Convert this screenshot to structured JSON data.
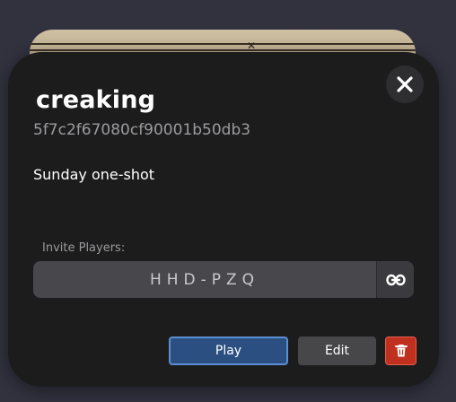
{
  "game": {
    "name": "creaking",
    "id": "5f7c2f67080cf90001b50db3",
    "description": "Sunday one-shot"
  },
  "invite": {
    "label": "Invite Players:",
    "code": "HHD-PZQ",
    "copy_link_icon": "link-icon"
  },
  "actions": {
    "play_label": "Play",
    "edit_label": "Edit",
    "delete_icon": "trash-icon",
    "close_icon": "close-icon"
  },
  "colors": {
    "modal_bg": "#1c1c1d",
    "play_bg": "#2c4f81",
    "play_border": "#5b8fd2",
    "delete_bg": "#c0301f",
    "edit_bg": "#474749"
  }
}
